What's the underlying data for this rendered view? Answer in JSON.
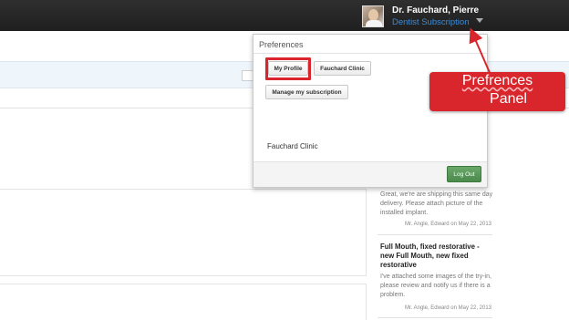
{
  "header": {
    "user_name": "Dr. Fauchard, Pierre",
    "subscription": "Dentist Subscription"
  },
  "preferences": {
    "title": "Preferences",
    "buttons": {
      "my_profile": "My Profile",
      "clinic": "Fauchard Clinic",
      "manage": "Manage my subscription"
    },
    "clinic_label": "Fauchard Clinic",
    "logout": "Log Out"
  },
  "feed": {
    "item1_text": "Great, we're are shipping this same day delivery. Please attach picture of the installed implant.",
    "item1_meta": "Mr. Angle, Edward on May 22, 2013",
    "item2_title": "Full Mouth, fixed restorative - new Full Mouth, new fixed restorative",
    "item2_text": "I've attached some images of the try-in, please review and notify us if there is a problem.",
    "item2_meta": "Mr. Angle, Edward on May 22, 2013"
  },
  "callout": {
    "line1": "Prefrences",
    "line2": "Panel"
  },
  "colors": {
    "callout": "#d9262c",
    "subscription_link": "#3a8ad6",
    "logout_button": "#5a9a5b",
    "topbar": "#262626"
  }
}
